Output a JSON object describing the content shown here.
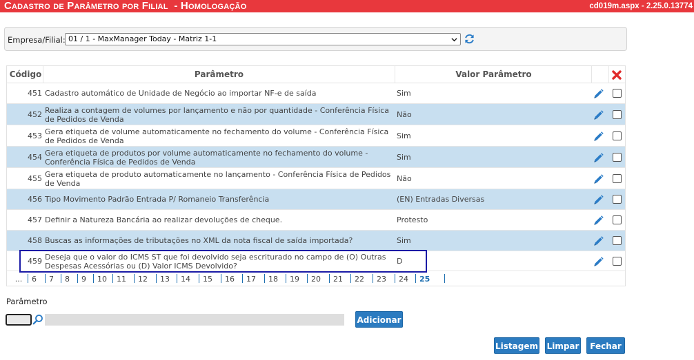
{
  "header": {
    "title": "Cadastro de Parâmetro por Filial  - Homologação",
    "version": "cd019m.aspx - 2.25.0.13774"
  },
  "company_filter": {
    "label": "Empresa/Filial:",
    "selected": "01 / 1 - MaxManager Today - Matriz 1-1"
  },
  "grid": {
    "columns": {
      "code": "Código",
      "parameter": "Parâmetro",
      "value": "Valor Parâmetro"
    },
    "rows": [
      {
        "code": "451",
        "parameter": "Cadastro automático de Unidade de Negócio ao importar NF-e de saída",
        "value": "Sim"
      },
      {
        "code": "452",
        "parameter": "Realiza a contagem de volumes por lançamento e não por quantidade - Conferência Física de Pedidos de Venda",
        "value": "Não"
      },
      {
        "code": "453",
        "parameter": "Gera etiqueta de volume automaticamente no fechamento do volume - Conferência Física de Pedidos de Venda",
        "value": "Sim"
      },
      {
        "code": "454",
        "parameter": "Gera etiqueta de produtos por volume automaticamente no fechamento do volume - Conferência Física de Pedidos de Venda",
        "value": "Sim"
      },
      {
        "code": "455",
        "parameter": "Gera etiqueta de produto automaticamente no lançamento - Conferência Física de Pedidos de Venda",
        "value": "Não"
      },
      {
        "code": "456",
        "parameter": "Tipo Movimento Padrão Entrada P/ Romaneio Transferência",
        "value": "(EN) Entradas Diversas"
      },
      {
        "code": "457",
        "parameter": "Definir a Natureza Bancária ao realizar devoluções de cheque.",
        "value": "Protesto"
      },
      {
        "code": "458",
        "parameter": "Buscas as informações de tributações no XML da nota fiscal de saída importada?",
        "value": "Sim"
      },
      {
        "code": "459",
        "parameter": "Deseja que o valor do ICMS ST que foi devolvido seja escriturado no campo de (O) Outras Despesas Acessórias ou (D) Valor ICMS Devolvido?",
        "value": "D"
      }
    ],
    "pager": {
      "ellipsis": "...",
      "pages": [
        "6",
        "7",
        "8",
        "9",
        "10",
        "11",
        "12",
        "13",
        "14",
        "15",
        "16",
        "17",
        "18",
        "19",
        "20",
        "21",
        "22",
        "23",
        "24",
        "25"
      ],
      "current": "25"
    },
    "icons": {
      "delete_header": "close-icon",
      "edit": "pencil-icon"
    }
  },
  "parameter_form": {
    "label": "Parâmetro",
    "code_value": "",
    "description_value": ""
  },
  "buttons": {
    "add": "Adicionar",
    "list": "Listagem",
    "clear": "Limpar",
    "close": "Fechar"
  },
  "colors": {
    "title_bar": "#e8383d",
    "alt_row": "#c8dff0",
    "button": "#2b7bc0",
    "selection_border": "#1a1aa6"
  }
}
